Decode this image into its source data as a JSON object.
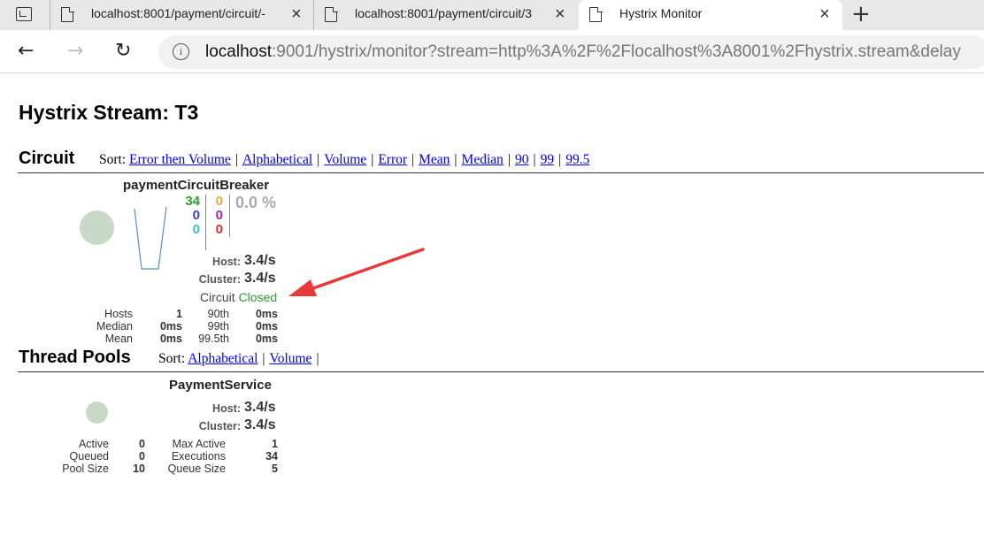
{
  "browser": {
    "tabs": [
      {
        "title": "localhost:8001/payment/circuit/-"
      },
      {
        "title": "localhost:8001/payment/circuit/3"
      },
      {
        "title": "Hystrix Monitor"
      }
    ],
    "url_host": "localhost",
    "url_rest": ":9001/hystrix/monitor?stream=http%3A%2F%2Flocalhost%3A8001%2Fhystrix.stream&delay"
  },
  "page": {
    "title": "Hystrix Stream: T3"
  },
  "circuit_section": {
    "title": "Circuit",
    "sort_label": "Sort:",
    "sort_links": [
      "Error then Volume",
      "Alphabetical",
      "Volume",
      "Error",
      "Mean",
      "Median",
      "90",
      "99",
      "99.5"
    ]
  },
  "circuit": {
    "name": "paymentCircuitBreaker",
    "success": "34",
    "short_circuited": "0",
    "bad_request": "0",
    "timeout": "0",
    "rejected": "0",
    "failure": "0",
    "error_pct": "0.0 %",
    "host_label": "Host:",
    "host_rate": "3.4/s",
    "cluster_label": "Cluster:",
    "cluster_rate": "3.4/s",
    "status_prefix": "Circuit",
    "status": "Closed",
    "stats": {
      "hosts_label": "Hosts",
      "hosts": "1",
      "median_label": "Median",
      "median": "0ms",
      "mean_label": "Mean",
      "mean": "0ms",
      "p90_label": "90th",
      "p90": "0ms",
      "p99_label": "99th",
      "p99": "0ms",
      "p995_label": "99.5th",
      "p995": "0ms"
    },
    "colors": {
      "success": "#2d9b2d",
      "short_circuited": "#3a3ad6",
      "bad_request": "#32c8c8",
      "timeout": "#f0a830",
      "rejected": "#9b2d9b",
      "failure": "#e03030",
      "closed": "#2d9b2d"
    }
  },
  "threadpool_section": {
    "title": "Thread Pools",
    "sort_label": "Sort:",
    "sort_links": [
      "Alphabetical",
      "Volume"
    ]
  },
  "threadpool": {
    "name": "PaymentService",
    "host_label": "Host:",
    "host_rate": "3.4/s",
    "cluster_label": "Cluster:",
    "cluster_rate": "3.4/s",
    "stats": {
      "active_label": "Active",
      "active": "0",
      "queued_label": "Queued",
      "queued": "0",
      "pool_size_label": "Pool Size",
      "pool_size": "10",
      "max_active_label": "Max Active",
      "max_active": "1",
      "executions_label": "Executions",
      "executions": "34",
      "queue_size_label": "Queue Size",
      "queue_size": "5"
    }
  },
  "annotation": {
    "arrow_color": "#e8393a"
  }
}
